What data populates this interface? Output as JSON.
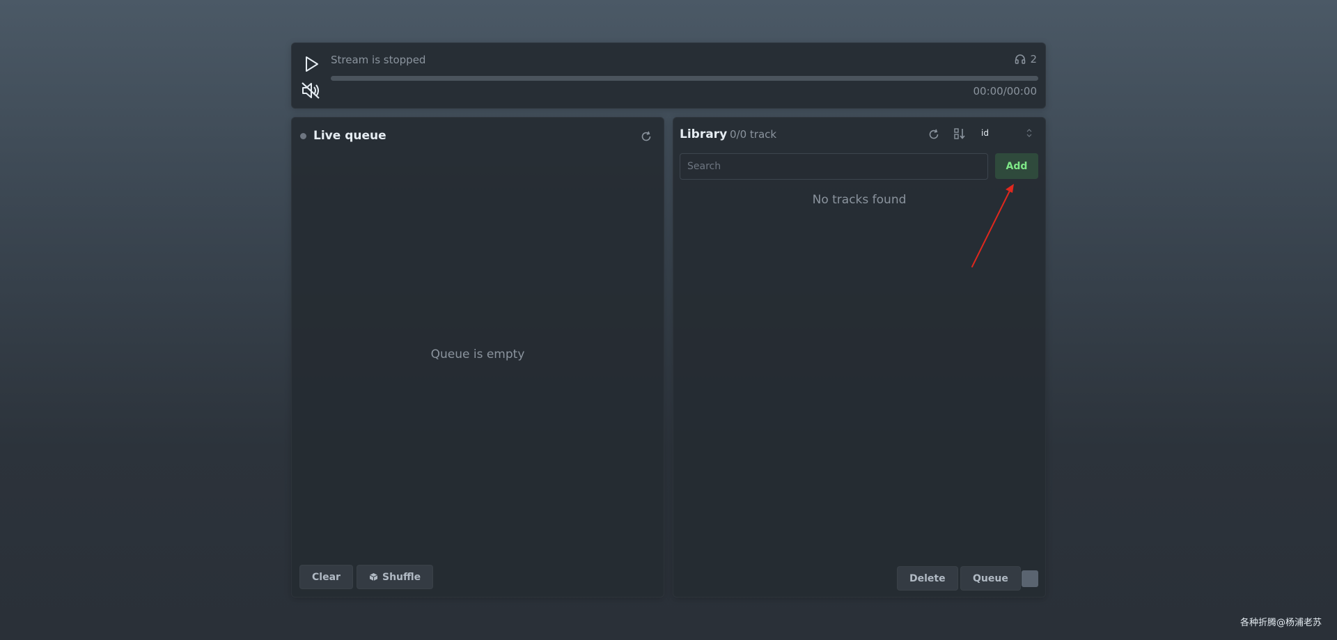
{
  "player": {
    "status": "Stream is stopped",
    "listener_count": "2",
    "time": "00:00/00:00",
    "progress_fraction": 0,
    "icons": {
      "play": "play-icon",
      "mute": "volume-muted-icon",
      "listeners": "headphones-icon"
    }
  },
  "queue": {
    "title": "Live queue",
    "empty_text": "Queue is empty",
    "clear_label": "Clear",
    "shuffle_label": "Shuffle",
    "icons": {
      "status": "status-dot-icon",
      "refresh": "refresh-icon",
      "shuffle": "cube-icon"
    }
  },
  "library": {
    "title": "Library",
    "track_count": "0/0 track",
    "sort_value": "id",
    "search_placeholder": "Search",
    "add_label": "Add",
    "empty_text": "No tracks found",
    "delete_label": "Delete",
    "queue_label": "Queue",
    "icons": {
      "refresh": "refresh-icon",
      "sort": "sort-order-icon",
      "sort_chevron": "chevron-up-down-icon"
    }
  },
  "annotation": {
    "arrow_color": "#e0281e"
  },
  "watermark": "各种折腾@杨浦老苏",
  "colors": {
    "accent_green": "#7ee787",
    "add_button_bg": "#2f4a3c",
    "panel_bg": "#252b32"
  }
}
